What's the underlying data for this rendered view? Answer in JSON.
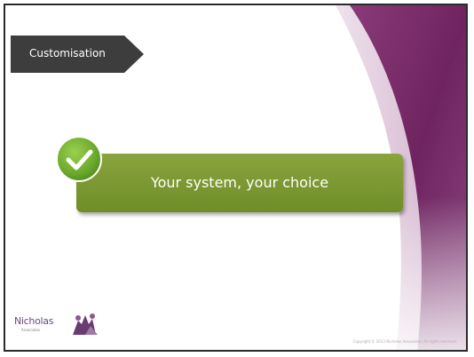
{
  "slide": {
    "section_label": "Customisation",
    "callout_text": "Your system, your choice",
    "logo_name": "Nicholas",
    "logo_sub": "Associates",
    "copyright": "Copyright © 2013 Nicholas Associates. All rights reserved."
  },
  "colors": {
    "accent_purple": "#7a2a6a",
    "tab_dark": "#3a3a3a",
    "callout_green": "#7d9a34",
    "badge_green": "#6aa82c"
  },
  "icons": {
    "badge": "checkmark-icon",
    "logo_mark": "people-logo-icon"
  }
}
